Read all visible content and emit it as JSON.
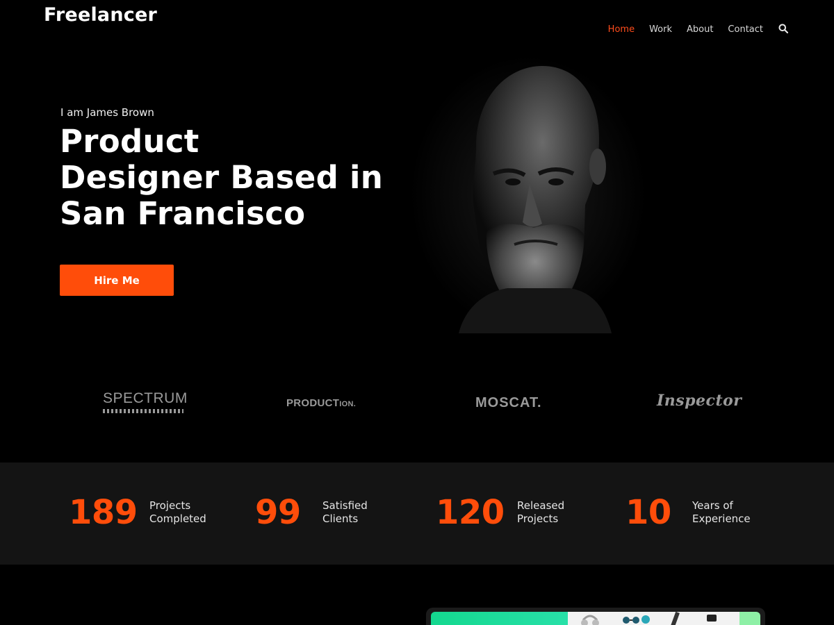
{
  "header": {
    "brand": "Freelancer",
    "nav": [
      {
        "label": "Home",
        "active": true
      },
      {
        "label": "Work",
        "active": false
      },
      {
        "label": "About",
        "active": false
      },
      {
        "label": "Contact",
        "active": false
      }
    ],
    "search_icon": "search-icon"
  },
  "hero": {
    "eyebrow": "I am James Brown",
    "headline_lines": [
      "Product",
      "Designer Based in",
      "San Francisco"
    ],
    "cta_label": "Hire Me"
  },
  "logos": {
    "spectrum": "SPECTRUM",
    "production_main": "PRODUCT",
    "production_small": "ION.",
    "moscat": "MOSCAT.",
    "inspector": "Inspector"
  },
  "stats": [
    {
      "number": "189",
      "label_1": "Projects",
      "label_2": "Completed"
    },
    {
      "number": "99",
      "label_1": "Satisfied",
      "label_2": "Clients"
    },
    {
      "number": "120",
      "label_1": "Released",
      "label_2": "Projects"
    },
    {
      "number": "10",
      "label_1": "Years of",
      "label_2": "Experience"
    }
  ],
  "colors": {
    "accent": "#ff4d0a",
    "background": "#000000",
    "stats_band": "#141414"
  }
}
